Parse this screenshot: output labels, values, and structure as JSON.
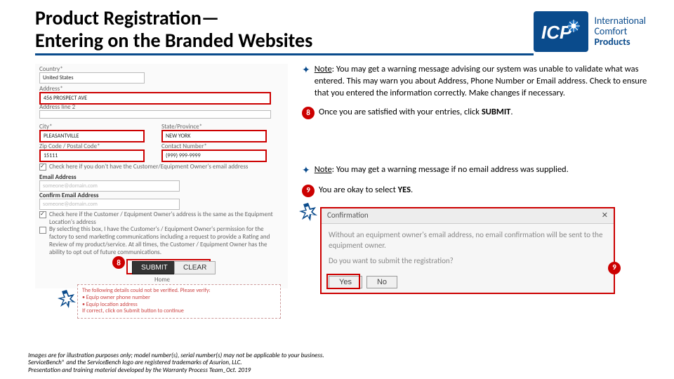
{
  "header": {
    "title_line1": "Product Registration—",
    "title_line2": "Entering on the Branded Websites",
    "logo_text1": "International",
    "logo_text2": "Comfort",
    "logo_text3": "Products"
  },
  "form": {
    "country_label": "Country*",
    "country_value": "United States",
    "address_label": "Address*",
    "address_value": "456 PROSPECT AVE",
    "address2_label": "Address line 2",
    "city_label": "City*",
    "city_value": "PLEASANTVILLE",
    "state_label": "State/Province*",
    "state_value": "NEW YORK",
    "zip_label": "Zip Code / Postal Code*",
    "zip_value": "15111",
    "contact_label": "Contact Number*",
    "contact_value": "(999) 999-9999",
    "email_chk_label": "Check here if you don't have the Customer/Equipment Owner's email address",
    "email_label": "Email Address",
    "email_ph": "someone@domain.com",
    "confirm_email_label": "Confirm Email Address",
    "same_addr_label": "Check here if the Customer / Equipment Owner's address is the same as the Equipment Location's address",
    "consent_text": "By selecting this box, I have the Customer's / Equipment Owner's permission for the factory to send marketing communications including a request to provide a Rating and Review of my product/service. At all times, the Customer / Equipment Owner has the ability to opt out of future communications.",
    "submit": "SUBMIT",
    "clear": "CLEAR",
    "home": "Home",
    "warn1": "The following details could not be verified. Please verify:",
    "warn2": "• Equip owner phone number",
    "warn3": "• Equip location address",
    "warn4": "If correct, click on Submit button to continue"
  },
  "steps": {
    "note1_label": "Note",
    "note1_text": ": You may get a warning message advising our system was unable to validate what was entered. This may warn you about Address, Phone Number or Email address. Check to ensure that you entered the information correctly. Make changes if necessary.",
    "step8_num": "8",
    "step8_text_a": "Once you are satisfied with your entries, click ",
    "step8_bold": "SUBMIT",
    "step8_text_b": ".",
    "note2_label": "Note",
    "note2_text": ": You may get a warning message if no email address was supplied.",
    "step9_num": "9",
    "step9_text_a": "You are okay to select ",
    "step9_bold": "YES",
    "step9_text_b": "."
  },
  "confirm": {
    "title": "Confirmation",
    "body1": "Without an equipment owner's email address, no email confirmation will be sent to the equipment owner.",
    "body2": "Do you want to submit the registration?",
    "yes": "Yes",
    "no": "No"
  },
  "markers": {
    "m8": "8",
    "m9": "9"
  },
  "footer": {
    "l1": "Images are for illustration purposes only; model number(s), serial number(s) may not be applicable to your business.",
    "l2": "ServiceBench® and the ServiceBench logo are registered trademarks of Asurion, LLC.",
    "l3": "Presentation and training material developed by the Warranty Process Team_Oct. 2019"
  }
}
